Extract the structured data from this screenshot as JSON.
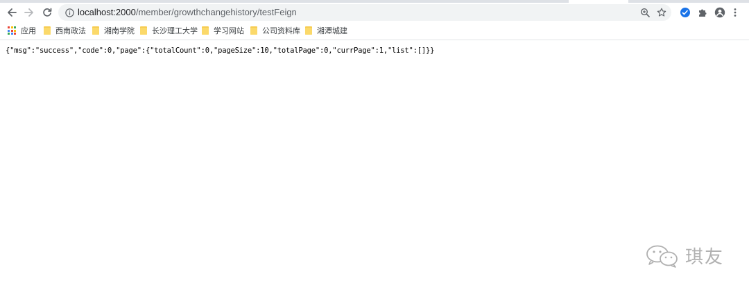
{
  "browser": {
    "address_bar": {
      "host": "localhost:2000",
      "path": "/member/growthchangehistory/testFeign"
    },
    "icons": {
      "back": "back-arrow-icon",
      "forward": "forward-arrow-icon",
      "reload": "reload-icon",
      "site_info": "info-icon",
      "zoom": "zoom-icon",
      "bookmark_star": "star-icon",
      "extension": "extension-icon",
      "puzzle": "puzzle-icon",
      "profile": "profile-icon",
      "menu": "kebab-menu-icon"
    }
  },
  "bookmarks": [
    {
      "label": "应用",
      "type": "apps"
    },
    {
      "label": "西南政法",
      "type": "folder"
    },
    {
      "label": "湘南学院",
      "type": "folder"
    },
    {
      "label": "长沙理工大学",
      "type": "folder"
    },
    {
      "label": "学习网站",
      "type": "folder"
    },
    {
      "label": "公司资料库",
      "type": "folder"
    },
    {
      "label": "湘潭城建",
      "type": "folder"
    }
  ],
  "page": {
    "json_text": "{\"msg\":\"success\",\"code\":0,\"page\":{\"totalCount\":0,\"pageSize\":10,\"totalPage\":0,\"currPage\":1,\"list\":[]}}"
  },
  "watermark": {
    "text": "琪友",
    "icon": "wechat-icon"
  },
  "colors": {
    "toolbar_icon": "#5f6368",
    "omnibox_bg": "#f1f3f4",
    "folder": "#f6cc52",
    "extension_blue": "#1a73e8",
    "watermark": "#b0b0b0"
  }
}
